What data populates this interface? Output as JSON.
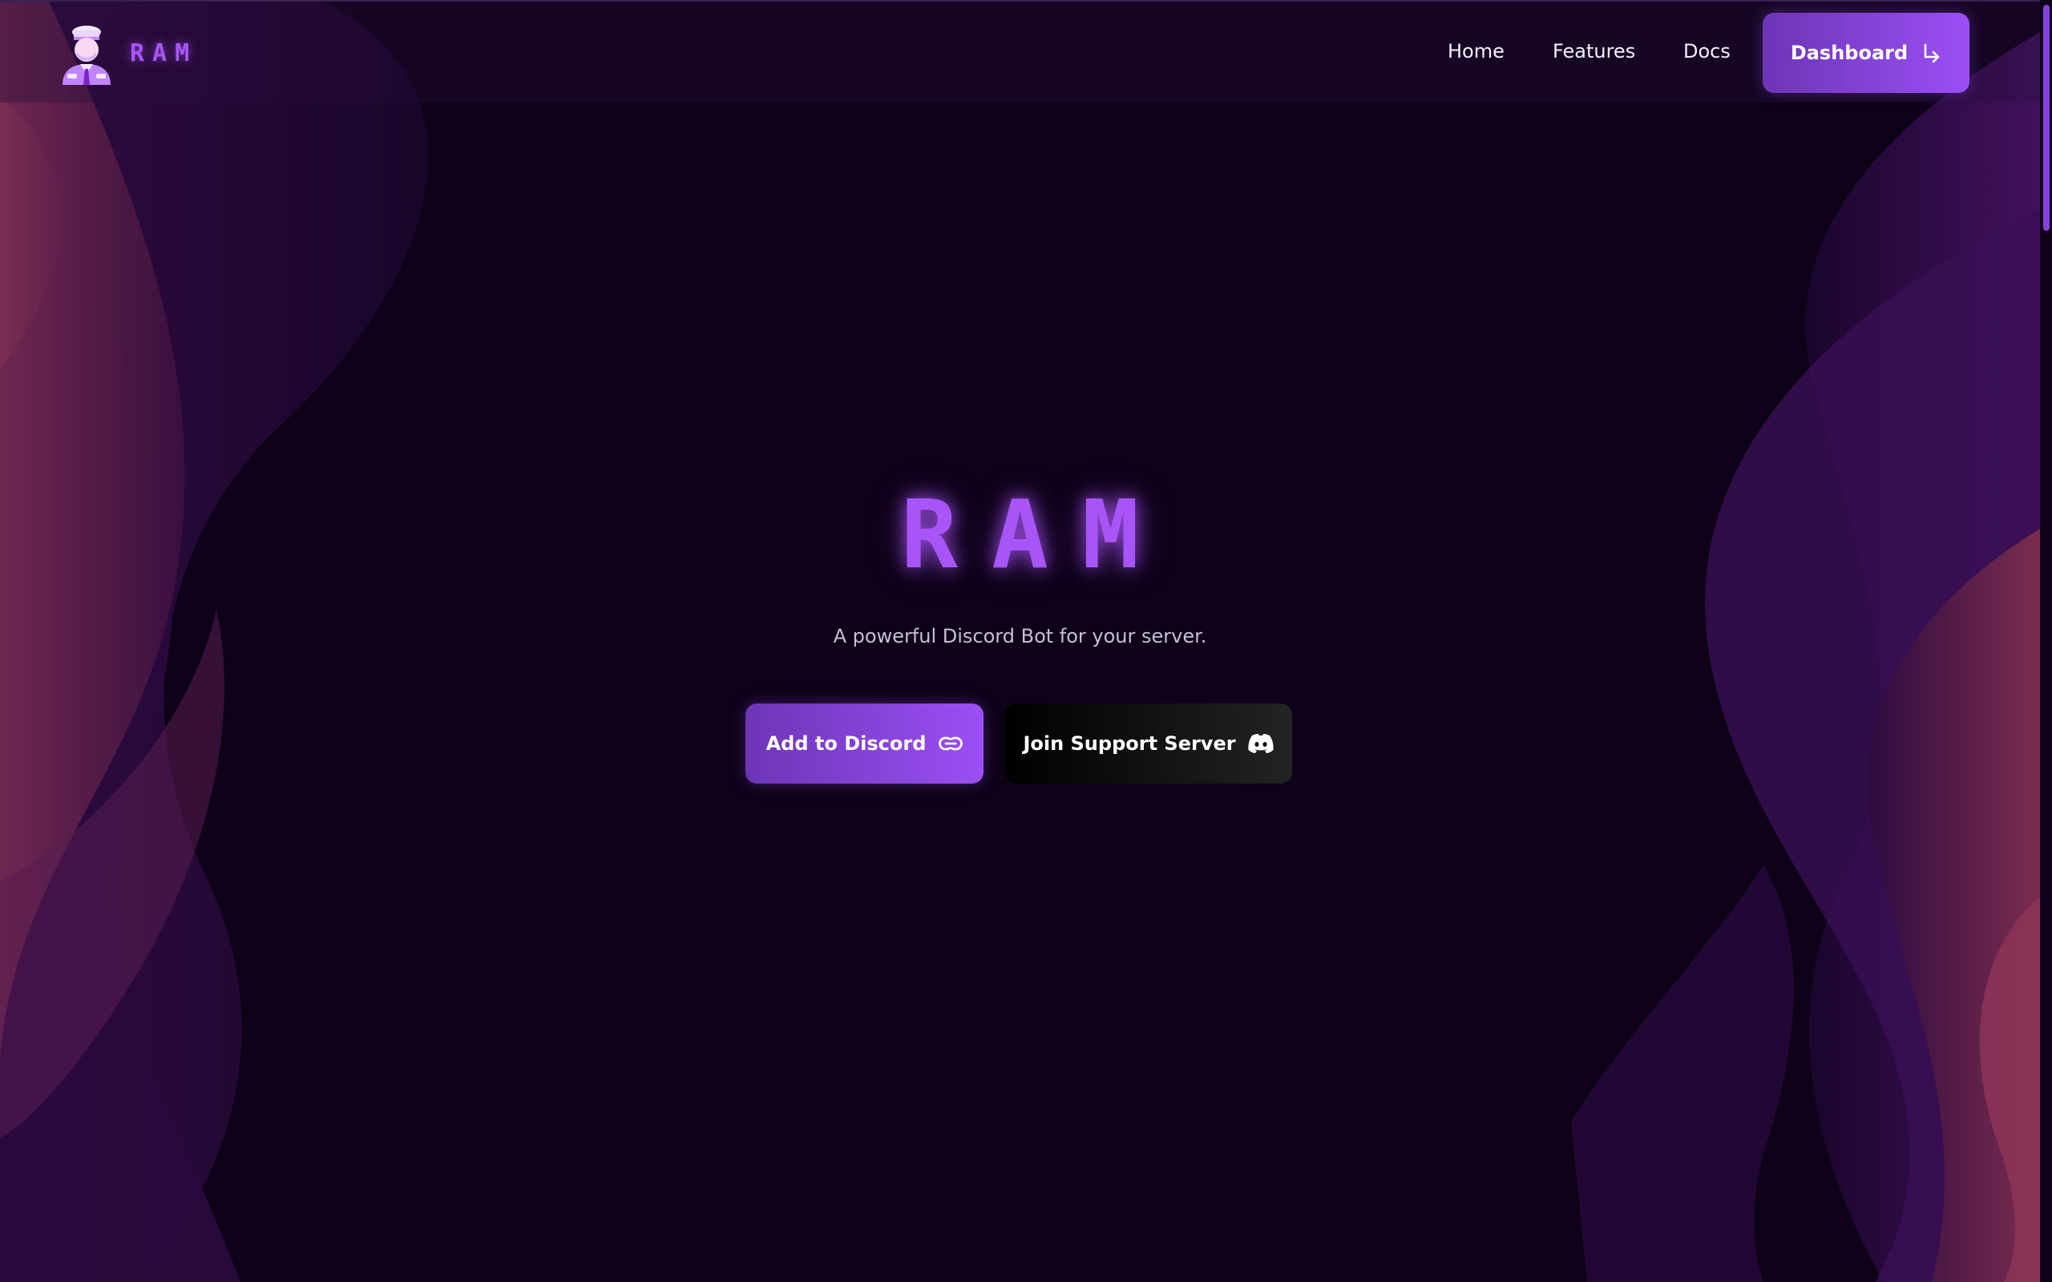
{
  "colors": {
    "background": "#0d0217",
    "accent": "#a855f7",
    "button_gradient_start": "#6d35b6",
    "button_gradient_end": "#9c4ff5",
    "wave_pink": "#7a2a4c",
    "wave_purple": "#3c0f55"
  },
  "header": {
    "brand_name": "RAM",
    "logo_icon": "bot-avatar-icon",
    "nav": {
      "home": "Home",
      "features": "Features",
      "docs": "Docs"
    },
    "dashboard_label": "Dashboard",
    "dashboard_icon": "arrow-enter-icon"
  },
  "hero": {
    "title": "RAM",
    "subtitle": "A powerful Discord Bot for your server.",
    "add_button_label": "Add to Discord",
    "add_button_icon": "link-icon",
    "support_button_label": "Join Support Server",
    "support_button_icon": "discord-icon"
  }
}
